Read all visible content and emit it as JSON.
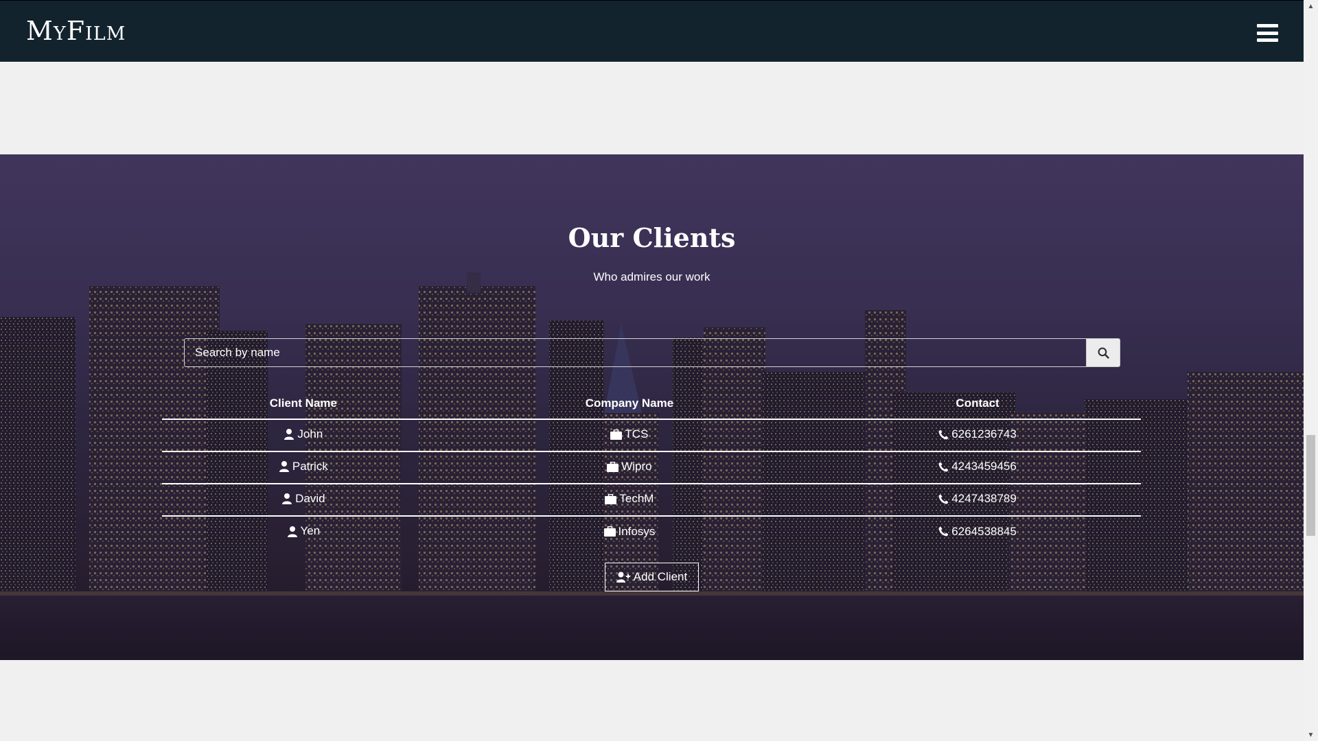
{
  "navbar": {
    "brand": "MyFilm",
    "menu_icon": "hamburger-menu-icon"
  },
  "clients_section": {
    "title": "Our Clients",
    "subtitle": "Who admires our work",
    "search": {
      "placeholder": "Search by name",
      "value": "",
      "icon": "search-icon"
    },
    "table": {
      "headers": [
        "Client Name",
        "Company Name",
        "Contact"
      ],
      "rows": [
        {
          "client": "John",
          "company": "TCS",
          "contact": "6261236743"
        },
        {
          "client": "Patrick",
          "company": "Wipro",
          "contact": "4243459456"
        },
        {
          "client": "David",
          "company": "TechM",
          "contact": "4247438789"
        },
        {
          "client": "Yen",
          "company": "Infosys",
          "contact": "6264538845"
        }
      ]
    },
    "add_button": {
      "label": "Add Client",
      "icon": "user-plus-icon"
    }
  },
  "colors": {
    "navbar_bg": "#12232e",
    "page_bg": "#f0f0f0",
    "text": "#ffffff"
  }
}
